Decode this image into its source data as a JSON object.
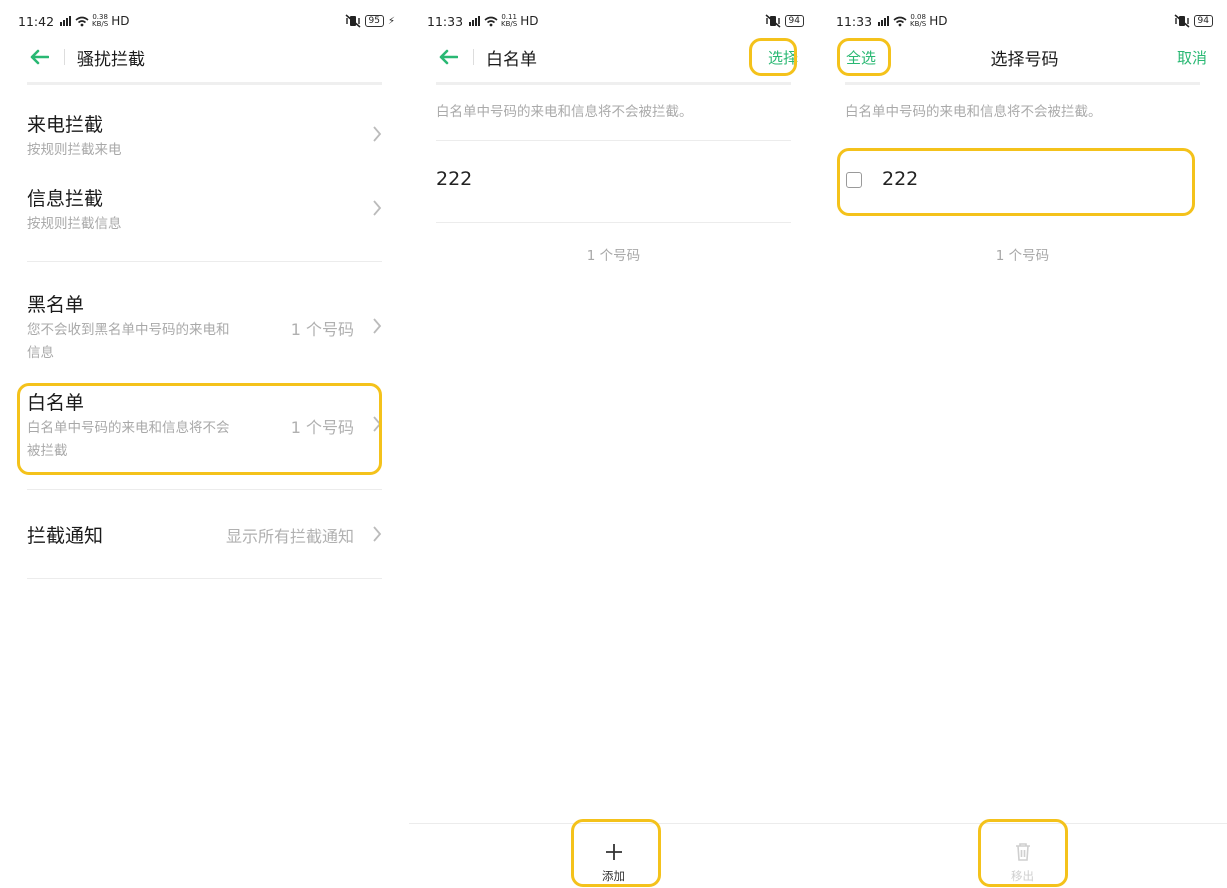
{
  "colors": {
    "accent": "#29b873",
    "highlight": "#f4c21b",
    "secondary_text": "#aaaaaa"
  },
  "panel1": {
    "status": {
      "time": "11:42",
      "speed_top": "0.38",
      "speed_bottom": "KB/S",
      "hd": "HD",
      "battery": "95"
    },
    "header": {
      "back_icon": "arrow-left-icon",
      "title": "骚扰拦截"
    },
    "items": [
      {
        "title": "来电拦截",
        "subtitle": "按规则拦截来电",
        "value": ""
      },
      {
        "title": "信息拦截",
        "subtitle": "按规则拦截信息",
        "value": ""
      },
      {
        "title": "黑名单",
        "subtitle_line1": "您不会收到黑名单中号码的来电和",
        "subtitle_line2": "信息",
        "value": "1 个号码"
      },
      {
        "title": "白名单",
        "subtitle_line1": "白名单中号码的来电和信息将不会",
        "subtitle_line2": "被拦截",
        "value": "1 个号码"
      },
      {
        "title": "拦截通知",
        "value": "显示所有拦截通知"
      }
    ]
  },
  "panel2": {
    "status": {
      "time": "11:33",
      "speed_top": "0.11",
      "speed_bottom": "KB/S",
      "hd": "HD",
      "battery": "94"
    },
    "header": {
      "back_icon": "arrow-left-icon",
      "title": "白名单",
      "action": "选择"
    },
    "note": "白名单中号码的来电和信息将不会被拦截。",
    "numbers": [
      "222"
    ],
    "count": "1 个号码",
    "bottom": {
      "icon": "plus-icon",
      "label": "添加"
    }
  },
  "panel3": {
    "status": {
      "time": "11:33",
      "speed_top": "0.08",
      "speed_bottom": "KB/S",
      "hd": "HD",
      "battery": "94"
    },
    "header": {
      "left_action": "全选",
      "title": "选择号码",
      "right_action": "取消"
    },
    "note": "白名单中号码的来电和信息将不会被拦截。",
    "numbers": [
      {
        "value": "222",
        "checked": false
      }
    ],
    "count": "1 个号码",
    "bottom": {
      "icon": "trash-icon",
      "label": "移出"
    }
  }
}
